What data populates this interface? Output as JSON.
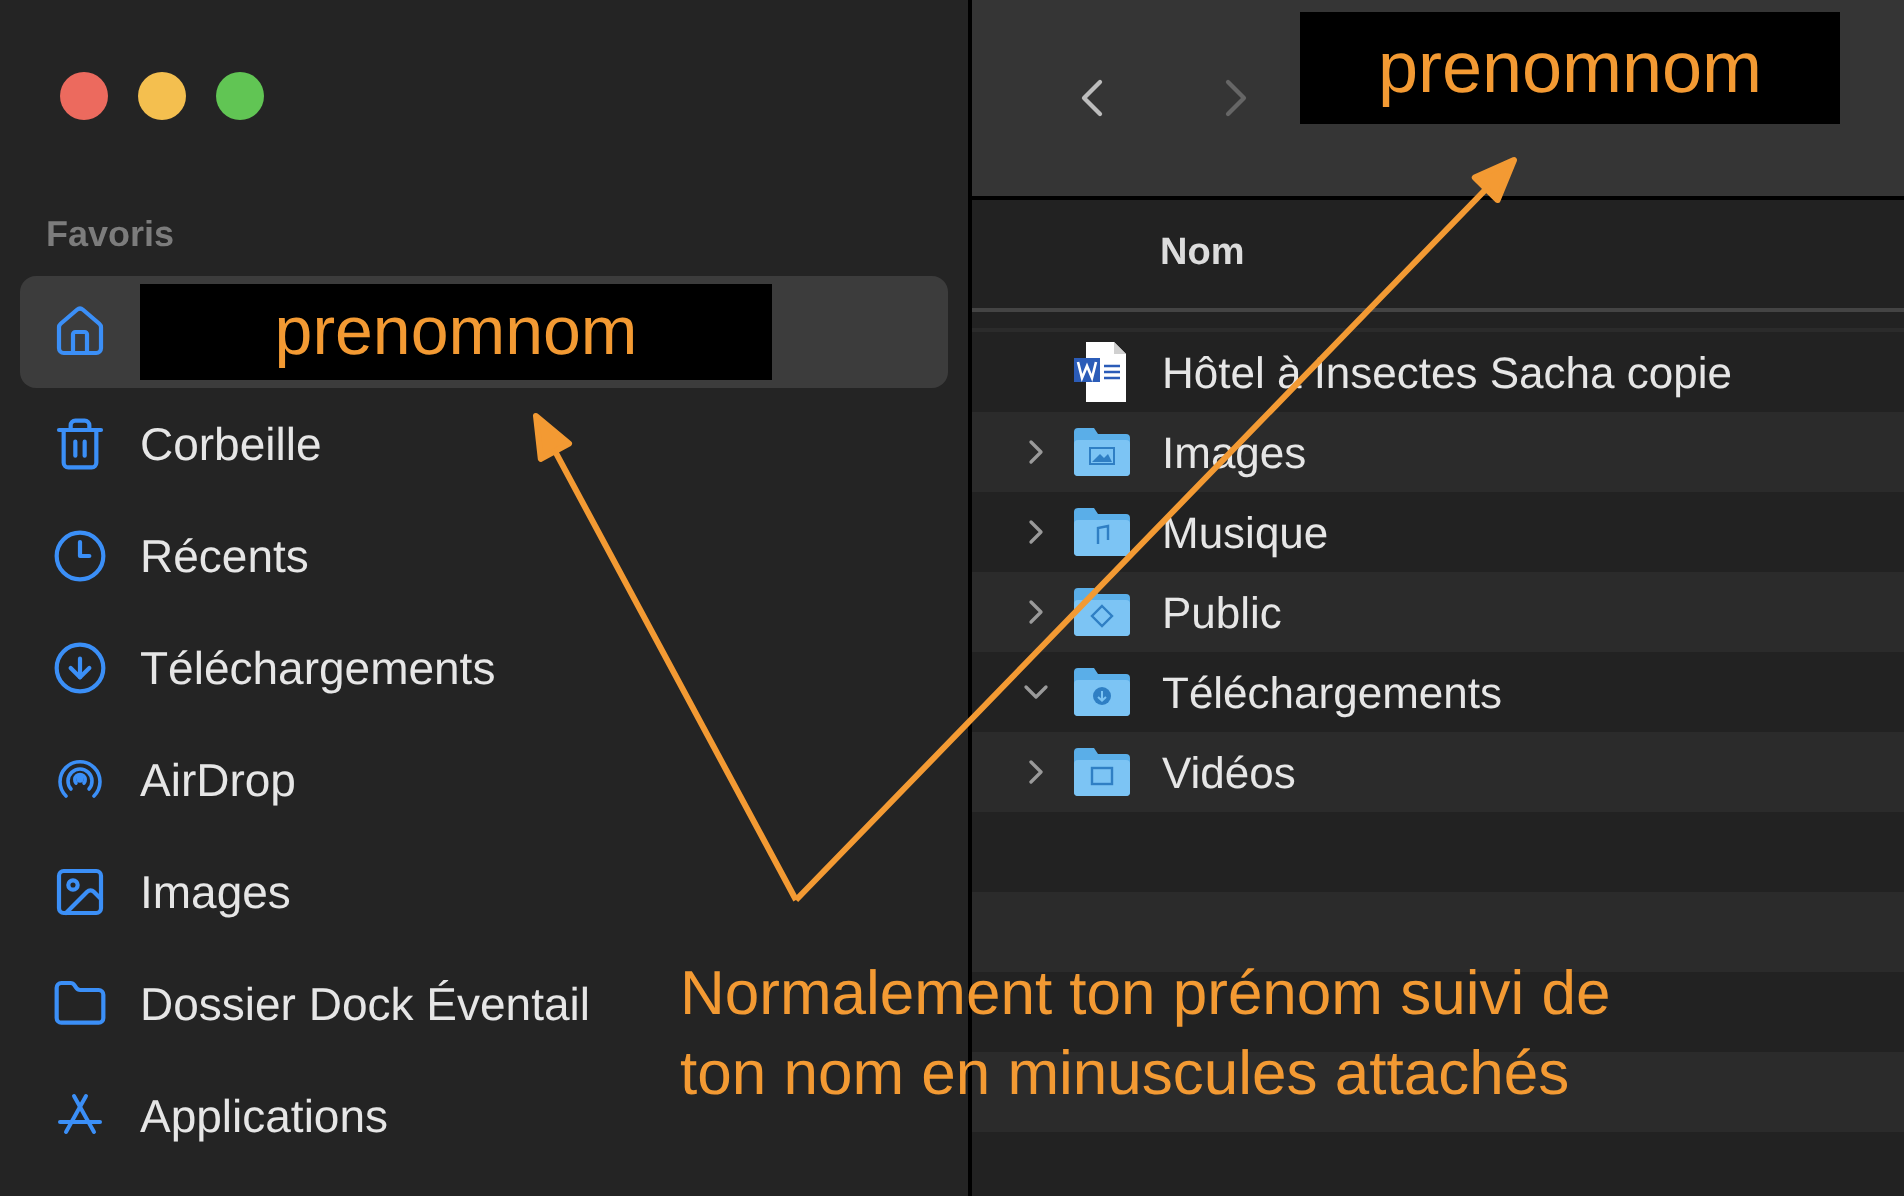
{
  "window": {
    "controls": [
      {
        "color": "#ec6a5e"
      },
      {
        "color": "#f4bf4f"
      },
      {
        "color": "#61c554"
      }
    ]
  },
  "sidebar": {
    "section": "Favoris",
    "items": [
      {
        "label": "prenomnom",
        "kind": "redacted",
        "selected": true
      },
      {
        "label": "Corbeille",
        "kind": "plain",
        "selected": false
      },
      {
        "label": "Récents",
        "kind": "plain",
        "selected": false
      },
      {
        "label": "Téléchargements",
        "kind": "plain",
        "selected": false
      },
      {
        "label": "AirDrop",
        "kind": "plain",
        "selected": false
      },
      {
        "label": "Images",
        "kind": "plain",
        "selected": false
      },
      {
        "label": "Dossier Dock Éventail",
        "kind": "plain",
        "selected": false
      },
      {
        "label": "Applications",
        "kind": "plain",
        "selected": false
      }
    ]
  },
  "toolbar": {
    "title": "prenomnom",
    "back_disabled": false,
    "forward_disabled": true
  },
  "list": {
    "column": "Nom",
    "rows": [
      {
        "name": "Hôtel à Insectes Sacha copie",
        "kind": "document"
      },
      {
        "name": "Images",
        "kind": "folder",
        "expanded": false
      },
      {
        "name": "Musique",
        "kind": "folder",
        "expanded": false
      },
      {
        "name": "Public",
        "kind": "folder",
        "expanded": false
      },
      {
        "name": "Téléchargements",
        "kind": "folder",
        "expanded": true
      },
      {
        "name": "Vidéos",
        "kind": "folder",
        "expanded": false
      }
    ]
  },
  "annotation": {
    "lines": [
      "Normalement ton prénom suivi de",
      "ton nom en minuscules attachés"
    ]
  }
}
